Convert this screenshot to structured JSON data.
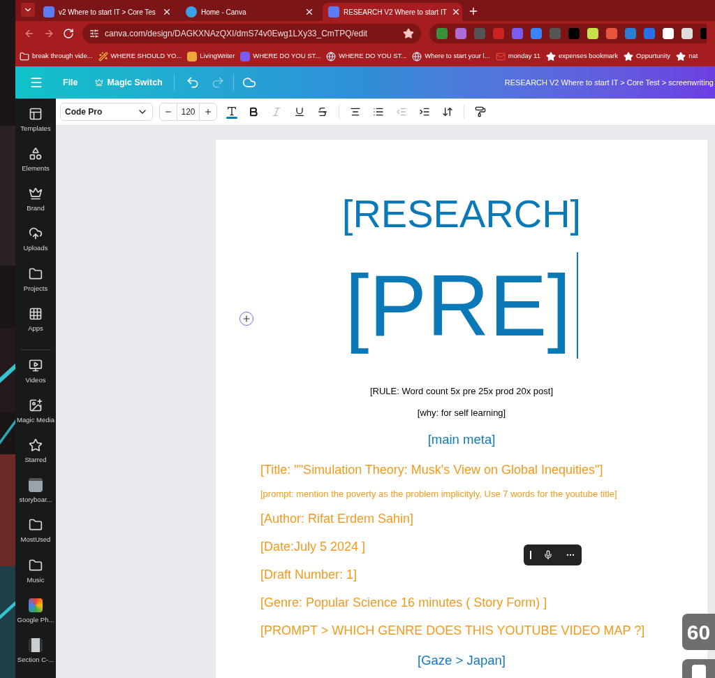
{
  "browser": {
    "tabs": [
      {
        "title": "v2 Where to start IT > Core Tes",
        "selected": false,
        "kind": "canva"
      },
      {
        "title": "Home - Canva",
        "selected": false,
        "kind": "home"
      },
      {
        "title": "RESEARCH V2 Where to start IT",
        "selected": true,
        "kind": "canva"
      }
    ],
    "url": "canva.com/design/DAGKXNAzQXI/dmS74v0Ewg1LXy33_CmTPQ/edit",
    "bookmarks": [
      {
        "label": "break through vide...",
        "kind": "folder"
      },
      {
        "label": "WHERE SHOULD YO...",
        "kind": "wand"
      },
      {
        "label": "LivingWriter",
        "kind": "w"
      },
      {
        "label": "WHERE DO YOU ST...",
        "kind": "app"
      },
      {
        "label": "WHERE DO YOU ST...",
        "kind": "globe"
      },
      {
        "label": "Where to start your l...",
        "kind": "globe"
      },
      {
        "label": "monday 11",
        "kind": "mail"
      },
      {
        "label": "expenses bookmark",
        "kind": "star"
      },
      {
        "label": "Oppurtunity",
        "kind": "star"
      },
      {
        "label": "nat",
        "kind": "star"
      }
    ]
  },
  "header": {
    "menu": [
      "File",
      "Magic Switch"
    ],
    "doc_title": "RESEARCH  V2 Where to start IT >  Core Test > screenwriting"
  },
  "toolbar": {
    "font": "Code Pro",
    "size": "120",
    "tools": [
      {
        "kind": "color",
        "disabled": false
      },
      {
        "kind": "bold",
        "disabled": false
      },
      {
        "kind": "italic",
        "disabled": true
      },
      {
        "kind": "underline",
        "disabled": false
      },
      {
        "kind": "strike",
        "disabled": false
      },
      {
        "kind": "align",
        "disabled": false
      },
      {
        "kind": "list",
        "disabled": false
      },
      {
        "kind": "outdent",
        "disabled": true
      },
      {
        "kind": "indent",
        "disabled": false
      },
      {
        "kind": "spacing",
        "disabled": false
      },
      {
        "kind": "paint",
        "disabled": false
      }
    ]
  },
  "sidebar": [
    {
      "label": "Templates",
      "kind": "templates"
    },
    {
      "label": "Elements",
      "kind": "elements"
    },
    {
      "label": "Brand",
      "kind": "brand"
    },
    {
      "label": "Uploads",
      "kind": "uploads"
    },
    {
      "label": "Projects",
      "kind": "folder"
    },
    {
      "label": "Apps",
      "kind": "apps"
    },
    {
      "label": "Videos",
      "kind": "videos"
    },
    {
      "label": "Magic Media",
      "kind": "magic"
    },
    {
      "label": "Starred",
      "kind": "star"
    },
    {
      "label": "storyboar...",
      "kind": "thumb"
    },
    {
      "label": "MostUsed",
      "kind": "folder"
    },
    {
      "label": "Music",
      "kind": "folder"
    },
    {
      "label": "Google Ph...",
      "kind": "photos"
    },
    {
      "label": "Section C-...",
      "kind": "section"
    }
  ],
  "document": [
    {
      "kind": "title",
      "text": "[RESEARCH]"
    },
    {
      "kind": "big",
      "text": "[PRE]"
    },
    {
      "kind": "rule",
      "text": "[RULE: Word count 5x pre 25x prod 20x post]"
    },
    {
      "kind": "rule",
      "text": "[why: for self learning]"
    },
    {
      "kind": "section",
      "text": "[main meta]"
    },
    {
      "kind": "field",
      "text": "[Title: \"\"Simulation Theory: Musk's View on Global Inequities\"]"
    },
    {
      "kind": "note",
      "text": "[prompt: mention the poverty as the problem implicityly, Use 7 words for the youtube title]"
    },
    {
      "kind": "field",
      "text": "[Author: Rifat Erdem Sahin]"
    },
    {
      "kind": "field",
      "text": "[Date:July 5 2024 ]"
    },
    {
      "kind": "field",
      "text": "[Draft Number: 1]"
    },
    {
      "kind": "field",
      "text": "[Genre: Popular Science 16 minutes ( Story Form) ]"
    },
    {
      "kind": "field",
      "text": "[PROMPT > WHICH GENRE DOES THIS YOUTUBE VIDEO MAP ?]"
    },
    {
      "kind": "section",
      "text": "[Gaze > Japan]"
    }
  ],
  "badge": "60"
}
